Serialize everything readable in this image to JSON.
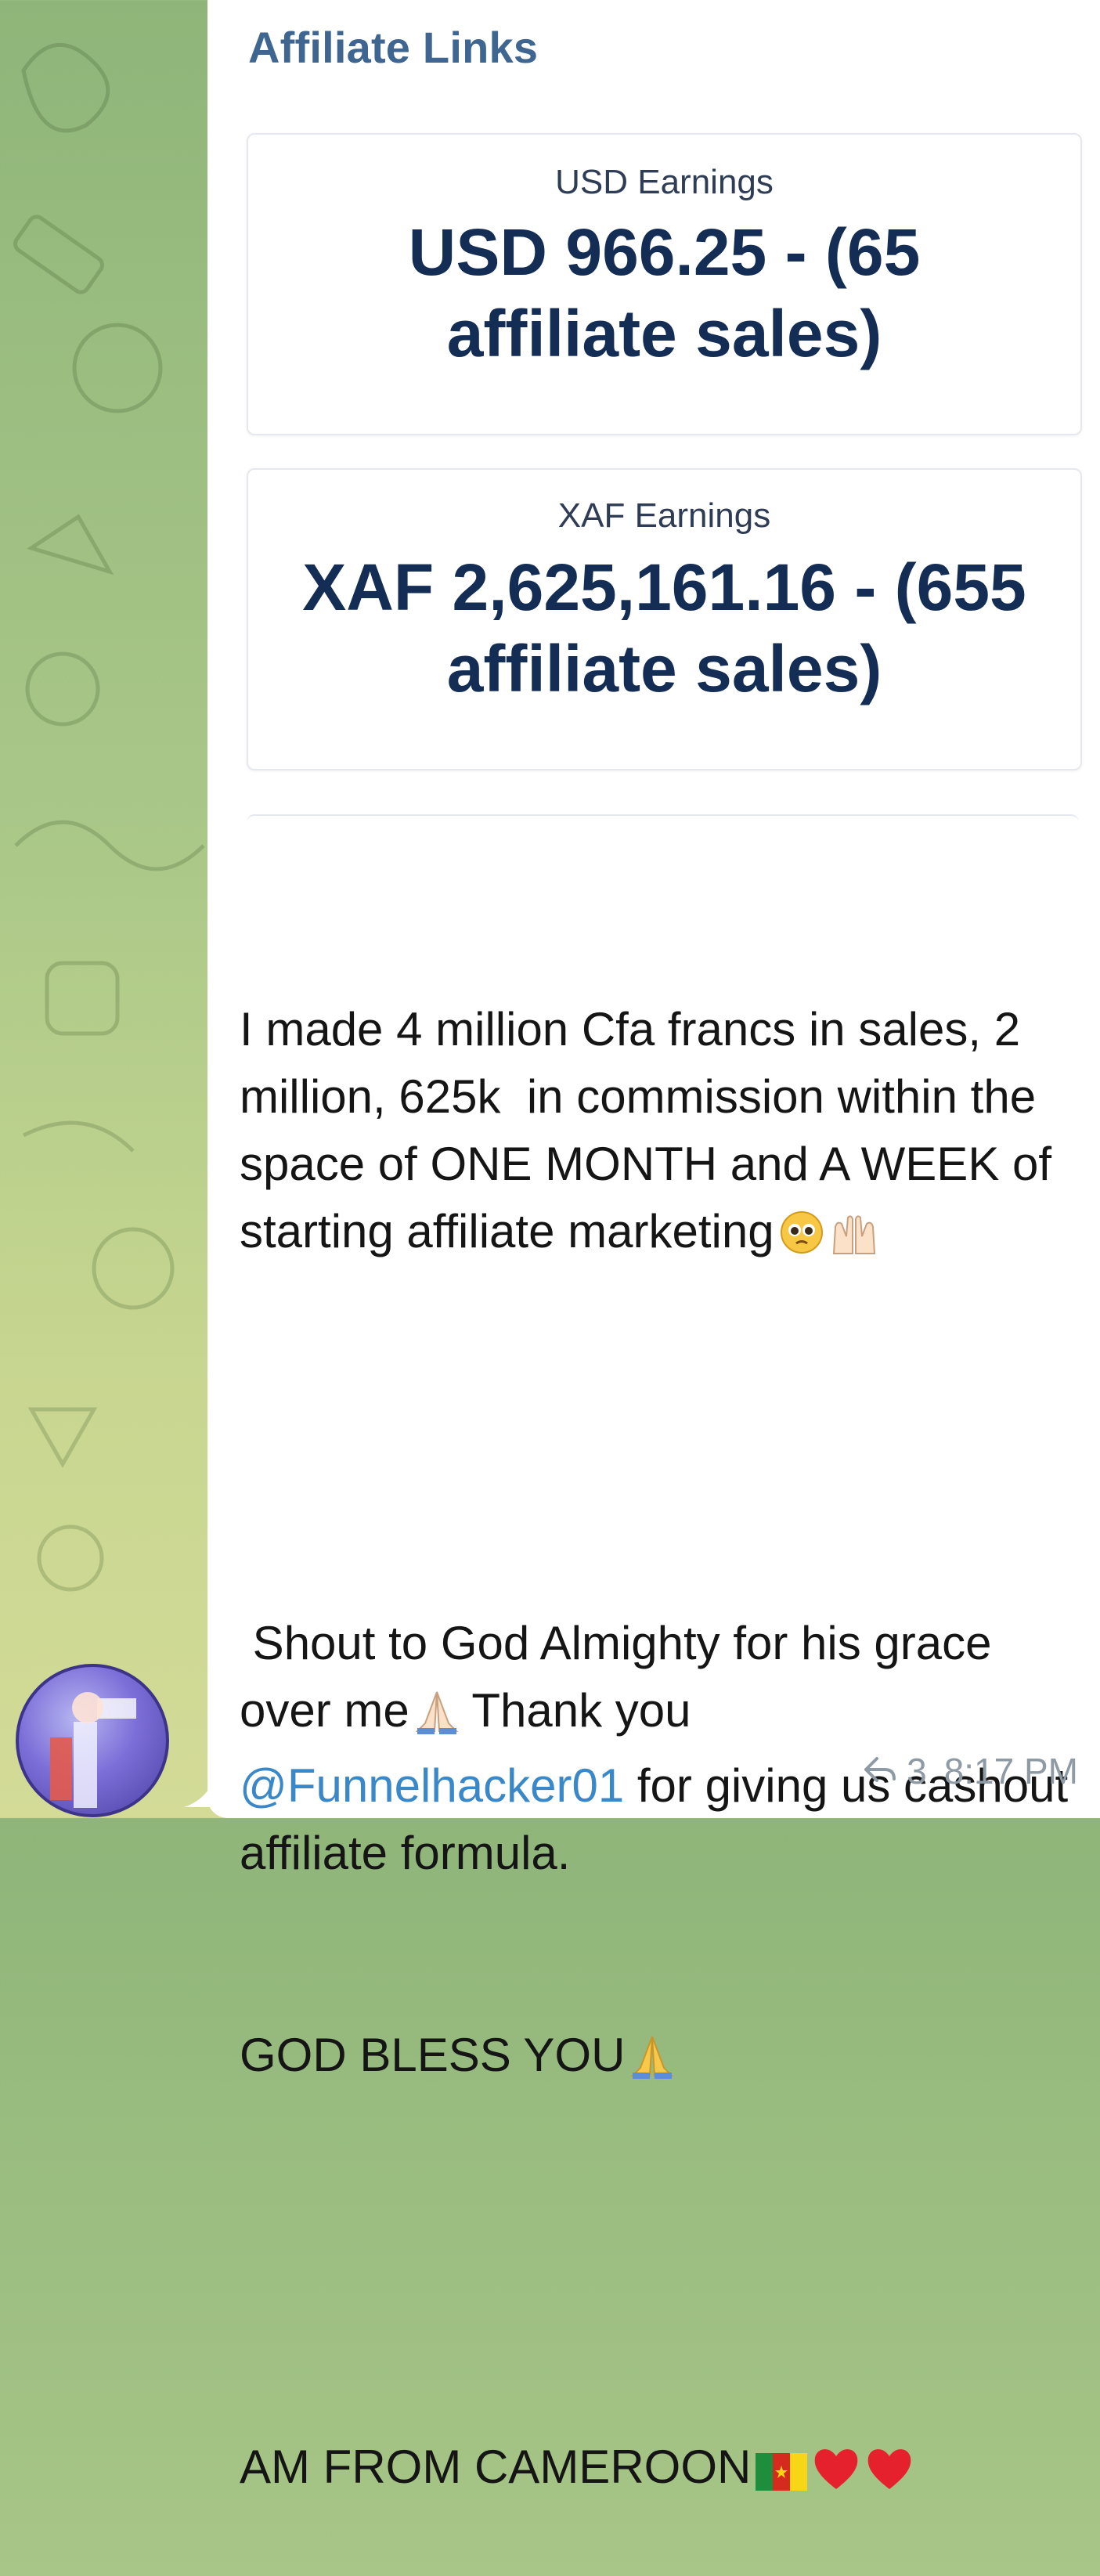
{
  "header": {
    "title": "Affiliate Links"
  },
  "cards": [
    {
      "label": "USD Earnings",
      "value": "USD 966.25 - (65 affiliate sales)"
    },
    {
      "label": "XAF Earnings",
      "value": "XAF 2,625,161.16 - (655 affiliate sales)"
    }
  ],
  "message": {
    "p1": "I made 4 million Cfa francs in sales, 2 million, 625k  in commission within the space of ONE MONTH and A WEEK of starting affiliate marketing",
    "p2a": " Shout to God Almighty for his grace over me",
    "p2b": " Thank you",
    "mention": "@Funnelhacker01",
    "p2c": " for giving us cashout affiliate formula.",
    "p3": "GOD BLESS YOU",
    "p4": "AM FROM CAMEROON"
  },
  "meta": {
    "reply_count": "3",
    "time": "8:17 PM"
  },
  "icons": [
    "pleading-face-emoji",
    "raised-hands-emoji",
    "folded-hands-emoji",
    "cameroon-flag-emoji",
    "red-heart-emoji",
    "reply-arrow-icon"
  ],
  "colors": {
    "header": "#3f6690",
    "mention": "#3a88c8",
    "meta": "#8e9aa4",
    "value": "#142d55"
  }
}
